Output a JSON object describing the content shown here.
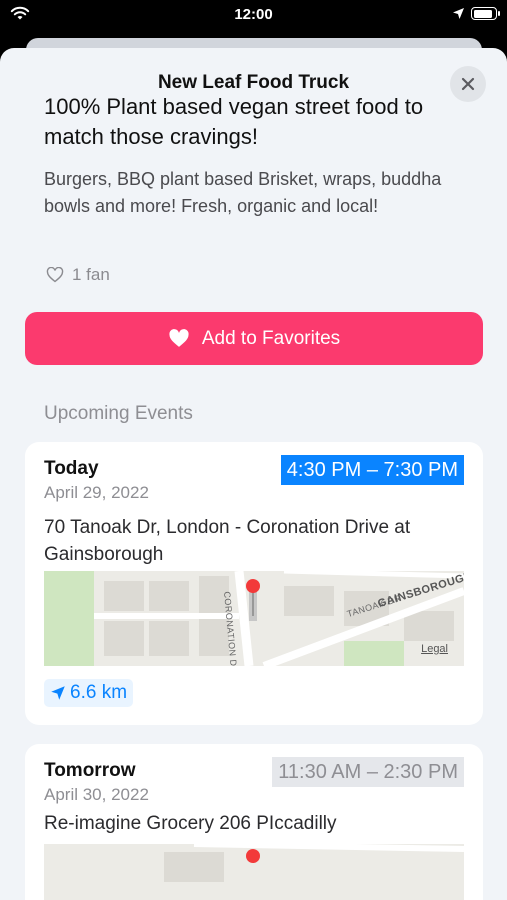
{
  "status_bar": {
    "time": "12:00",
    "icons": [
      "wifi-icon",
      "location-arrow-icon",
      "battery-icon"
    ]
  },
  "sheet": {
    "title": "New Leaf Food Truck",
    "close_icon": "close-icon"
  },
  "truck": {
    "headline": "100% Plant based vegan street food to match those cravings!",
    "description": "Burgers, BBQ plant based Brisket, wraps, buddha bowls and more! Fresh, organic and local!",
    "fans": "1 fan"
  },
  "favorite_button": {
    "label": "Add to Favorites"
  },
  "events_section": {
    "title": "Upcoming Events"
  },
  "events": [
    {
      "day": "Today",
      "date": "April 29, 2022",
      "time": "4:30 PM – 7:30 PM",
      "address": "70 Tanoak Dr, London - Coronation Drive at Gainsborough",
      "distance": "6.6 km",
      "map_labels": {
        "street1": "CORONATION DR",
        "street2": "TANOAK DR",
        "street3": "GAINSBOROUGH",
        "legal": "Legal"
      }
    },
    {
      "day": "Tomorrow",
      "date": "April 30, 2022",
      "time": "11:30 AM – 2:30 PM",
      "address": "Re-imagine Grocery  206 PIccadilly"
    }
  ],
  "colors": {
    "accent_pink": "#fb3a6e",
    "accent_blue": "#0a84ff"
  }
}
